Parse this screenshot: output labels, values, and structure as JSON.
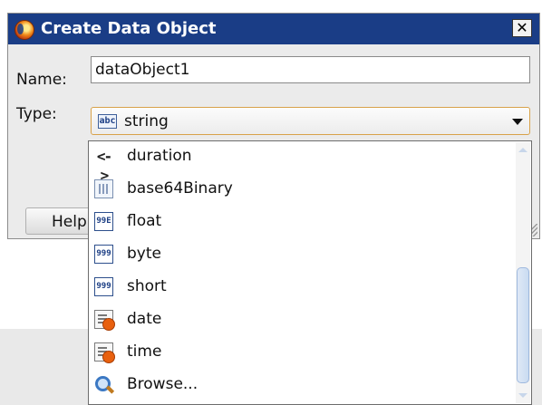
{
  "dialog": {
    "title": "Create Data Object",
    "close_symbol": "✕",
    "name_label": "Name:",
    "name_value": "dataObject1",
    "type_label": "Type:",
    "type_value": "string",
    "type_icon": "abc",
    "help_label": "Help"
  },
  "dropdown": {
    "items": [
      {
        "label": "duration",
        "icon": "<->"
      },
      {
        "label": "base64Binary",
        "icon": "binary-icon"
      },
      {
        "label": "float",
        "icon": "99E"
      },
      {
        "label": "byte",
        "icon": "999"
      },
      {
        "label": "short",
        "icon": "999"
      },
      {
        "label": "date",
        "icon": "calendar-clock-icon"
      },
      {
        "label": "time",
        "icon": "calendar-clock-icon"
      },
      {
        "label": "Browse...",
        "icon": "search-icon"
      }
    ]
  },
  "colors": {
    "titlebar": "#1a3d86",
    "accent_border": "#d8a24a"
  }
}
